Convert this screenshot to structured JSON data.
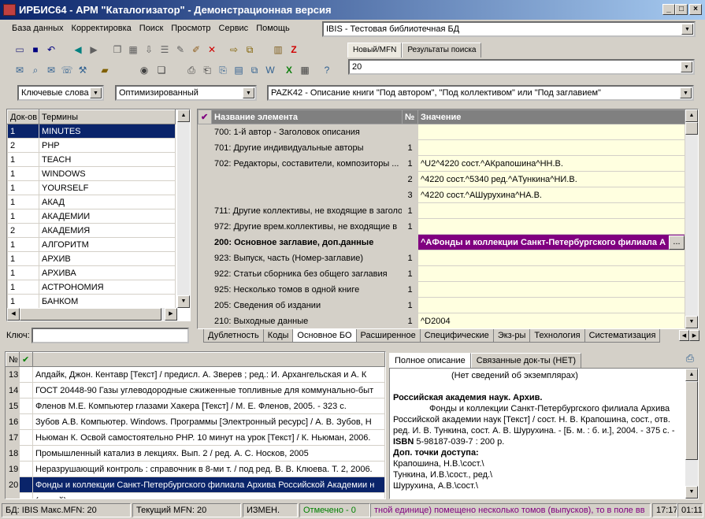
{
  "window": {
    "title": "ИРБИС64 - АРМ \"Каталогизатор\" - Демонстрационная версия",
    "min": "_",
    "max": "□",
    "close": "×"
  },
  "menu": [
    "База данных",
    "Корректировка",
    "Поиск",
    "Просмотр",
    "Сервис",
    "Помощь"
  ],
  "database_select": "IBIS - Тестовая библиотечная БД",
  "mfn_tabs": [
    "Новый/MFN",
    "Результаты поиска"
  ],
  "mfn_value": "20",
  "search": {
    "mode": "Ключевые слова",
    "method": "Оптимизированный",
    "worksheet": "PAZK42 - Описание книги \"Под автором\", \"Под коллективом\" или \"Под заглавием\""
  },
  "terms": {
    "headers": [
      "Док-ов",
      "Термины"
    ],
    "pin": "ᅟ",
    "rows": [
      [
        "1",
        "MINUTES"
      ],
      [
        "2",
        "PHP"
      ],
      [
        "1",
        "TEACH"
      ],
      [
        "1",
        "WINDOWS"
      ],
      [
        "1",
        "YOURSELF"
      ],
      [
        "1",
        "АКАД"
      ],
      [
        "1",
        "АКАДЕМИИ"
      ],
      [
        "2",
        "АКАДЕМИЯ"
      ],
      [
        "1",
        "АЛГОРИТМ"
      ],
      [
        "1",
        "АРХИВ"
      ],
      [
        "1",
        "АРХИВА"
      ],
      [
        "1",
        "АСТРОНОМИЯ"
      ],
      [
        "1",
        "БАНКОМ"
      ]
    ],
    "key_label": "Ключ:"
  },
  "editor": {
    "headers": [
      "Название элемента",
      "№",
      "Значение"
    ],
    "rows": [
      {
        "name": "700: 1-й автор - Заголовок описания",
        "num": "",
        "value": "",
        "bold": false,
        "hl": false
      },
      {
        "name": "701: Другие индивидуальные авторы",
        "num": "1",
        "value": "",
        "bold": false,
        "hl": false
      },
      {
        "name": "702: Редакторы, составители, композиторы ...",
        "num": "1",
        "value": "^U2^4220 сост.^AКрапошина^HН.В.",
        "bold": false,
        "hl": false
      },
      {
        "name": "",
        "num": "2",
        "value": "^4220 сост.^5340 ред.^AТункина^HИ.В.",
        "bold": false,
        "hl": false
      },
      {
        "name": "",
        "num": "3",
        "value": "^4220 сост.^AШурухина^HА.В.",
        "bold": false,
        "hl": false
      },
      {
        "name": "711: Другие коллективы, не входящие в заголо",
        "num": "1",
        "value": "",
        "bold": false,
        "hl": false
      },
      {
        "name": "972: Другие врем.коллективы, не входящие в",
        "num": "1",
        "value": "",
        "bold": false,
        "hl": false
      },
      {
        "name": "200: Основное заглавие, доп.данные",
        "num": "",
        "value": "^AФонды и коллекции Санкт-Петербургского филиала А",
        "bold": true,
        "hl": true
      },
      {
        "name": "923: Выпуск, часть (Номер-заглавие)",
        "num": "1",
        "value": "",
        "bold": false,
        "hl": false
      },
      {
        "name": "922: Статьи сборника без общего заглавия",
        "num": "1",
        "value": "",
        "bold": false,
        "hl": false
      },
      {
        "name": "925: Несколько томов в одной книге",
        "num": "1",
        "value": "",
        "bold": false,
        "hl": false
      },
      {
        "name": "205: Сведения об издании",
        "num": "1",
        "value": "",
        "bold": false,
        "hl": false
      },
      {
        "name": "210: Выходные данные",
        "num": "1",
        "value": "^D2004",
        "bold": false,
        "hl": false
      }
    ],
    "tabs": [
      "Дублетность",
      "Коды",
      "Основное БО",
      "Расширенное",
      "Специфические",
      "Экз-ры",
      "Технология",
      "Систематизация"
    ],
    "active_tab": "Основное БО",
    "ellipsis": "..."
  },
  "results": {
    "headers": [
      "№",
      "✔"
    ],
    "rows": [
      [
        "13",
        "Апдайк, Джон. Кентавр [Текст] / предисл. А. Зверев ; ред.: И. Архангельская и А. К"
      ],
      [
        "14",
        "ГОСТ 20448-90 Газы углеводородные сжиженные топливные для коммунально-быт"
      ],
      [
        "15",
        "Фленов М.Е. Компьютер глазами Хакера [Текст] / М. Е. Фленов, 2005. - 323 с."
      ],
      [
        "16",
        "Зубов А.В. Компьютер. Windows. Программы [Электронный ресурс] / А. В. Зубов, Н"
      ],
      [
        "17",
        "Ньюман К. Освой самостоятельно PHP. 10 минут на урок [Текст] / К. Ньюман, 2006."
      ],
      [
        "18",
        "Промышленный катализ в лекциях. Вып. 2 / ред. А. С. Носков, 2005"
      ],
      [
        "19",
        "Неразрушающий контроль : справочник в 8-ми т. / под ред. В. В. Клюева. Т. 2, 2006."
      ],
      [
        "20",
        "Фонды и коллекции Санкт-Петербургского филиала Архива Российской Академии н"
      ],
      [
        "",
        "(новый)"
      ]
    ]
  },
  "description": {
    "tabs": [
      "Полное описание",
      "Связанные док-ты (НЕТ)"
    ],
    "no_copies": "(Нет сведений об экземплярах)",
    "heading": "Российская академия наук. Архив.",
    "body": "Фонды и коллекции Санкт-Петербургского филиала Архива Российской академии наук [Текст] / сост. Н. В. Крапошина, сост., отв. ред. И. В. Тункина, сост. А. В. Шурухина. - [Б. м. : б. и.], 2004. - 375 с. -",
    "isbn_label": "ISBN",
    "isbn": "5-98187-039-7 : 200 р.",
    "access_label": "Доп. точки доступа:",
    "access": [
      "Крапошина, Н.В.\\сост.\\",
      "Тункина, И.В.\\сост., ред.\\",
      "Шурухина, А.В.\\сост.\\"
    ]
  },
  "status": {
    "db": "БД: IBIS Макс.MFN: 20",
    "current": "Текущий MFN: 20",
    "changed": "ИЗМЕН.",
    "marked": "Отмечено - 0",
    "hint": "тной единице) помещено несколько томов (выпусков), то в поле вв",
    "time1": "17:17",
    "time2": "01:11"
  },
  "colors": {
    "title_start": "#0a246a",
    "highlight": "#800080",
    "selection": "#0a246a",
    "editor_bg": "#ffffe0",
    "marked": "#008000",
    "hint": "#800080"
  }
}
